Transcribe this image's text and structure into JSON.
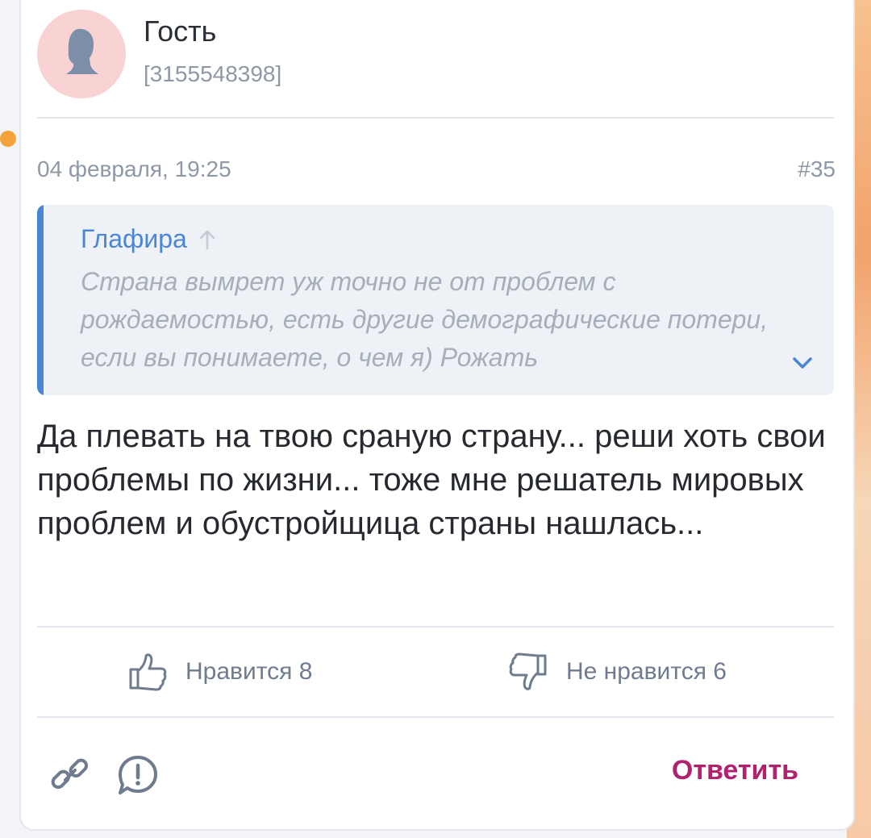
{
  "post": {
    "author": "Гость",
    "author_id": "[3155548398]",
    "date": "04 февраля, 19:25",
    "number": "#35",
    "quote": {
      "author": "Глафира",
      "text": "Страна вымрет уж точно не от проблем с рождаемостью, есть другие демографические потери, если вы понимаете, о чем я) Рожать"
    },
    "body": "Да плевать на твою сраную страну... реши хоть свои проблемы по жизни... тоже мне решатель мировых проблем и обустройщица страны нашлась...",
    "likes_label": "Нравится 8",
    "dislikes_label": "Не нравится 6",
    "reply_label": "Ответить"
  },
  "colors": {
    "accent_blue": "#4a86d6",
    "reply": "#b0216e",
    "avatar_bg": "#f9d3d3"
  },
  "icons": [
    "user-silhouette-icon",
    "arrow-up-icon",
    "chevron-down-icon",
    "thumbs-up-icon",
    "thumbs-down-icon",
    "link-icon",
    "report-icon"
  ]
}
